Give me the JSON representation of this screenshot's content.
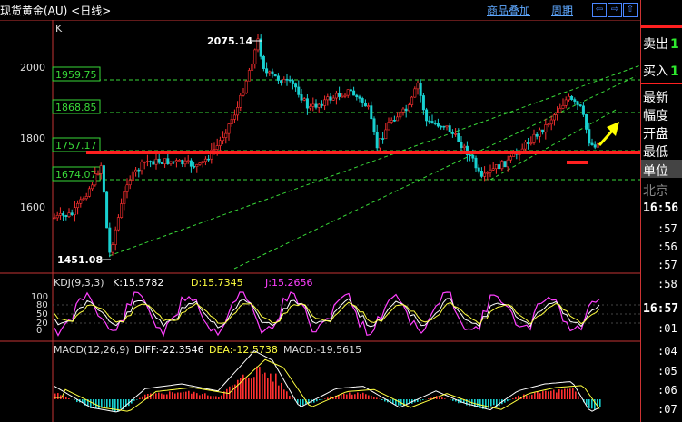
{
  "header": {
    "title": "现货黄金(AU) <日线>",
    "overlay_link": "商品叠加",
    "period_link": "周期",
    "nav_buttons": [
      "⇦",
      "⇨",
      "⇧"
    ]
  },
  "main_chart": {
    "corner_label": "K",
    "y_ticks": [
      "2000",
      "1800",
      "1600"
    ],
    "levels": [
      {
        "label": "1959.75",
        "value": 1959.75
      },
      {
        "label": "1868.85",
        "value": 1868.85
      },
      {
        "label": "1757.17",
        "value": 1757.17
      },
      {
        "label": "1674.07",
        "value": 1674.07
      }
    ],
    "high_label": "2075.14",
    "low_label": "1451.08"
  },
  "kdj": {
    "name": "KDJ(9,3,3)",
    "k": "K:15.5782",
    "d": "D:15.7345",
    "j": "J:15.2656",
    "y_ticks": [
      "100",
      "80",
      "50",
      "20",
      "0"
    ]
  },
  "macd": {
    "name": "MACD(12,26,9)",
    "diff": "DIFF:-22.3546",
    "dea": "DEA:-12.5738",
    "macd": "MACD:-19.5615"
  },
  "side_panel": {
    "sell_label": "卖出",
    "sell_value": "1",
    "buy_label": "买入",
    "buy_value": "1",
    "rows": [
      "最新",
      "幅度",
      "开盘",
      "最低"
    ],
    "unit_label": "单位",
    "city_label": "北京",
    "times": [
      "16:56",
      ":57",
      ":56",
      ":57",
      ":58",
      "16:57",
      ":01",
      ":04",
      ":05",
      ":06",
      ":07"
    ]
  },
  "colors": {
    "up": "#ff3030",
    "down": "#18d0d0",
    "level_line": "#38d838",
    "support_line": "#ff2020",
    "k_line": "#ffffff",
    "d_line": "#ffff40",
    "j_line": "#ff40ff",
    "arrow": "#ffff00",
    "axis": "#c33333"
  }
}
